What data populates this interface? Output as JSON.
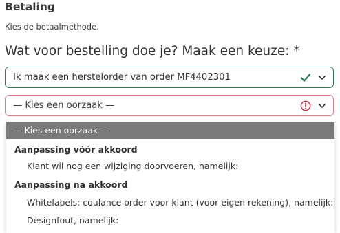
{
  "section": {
    "title": "Betaling",
    "subtitle": "Kies de betaalmethode."
  },
  "question": {
    "label": "Wat voor bestelling doe je? Maak een keuze: *"
  },
  "order_select": {
    "value": "Ik maak een herstelorder van order MF4402301",
    "status_icon": "check-icon",
    "status_color": "#2e7d55"
  },
  "reason_select": {
    "value": "— Kies een oorzaak —",
    "status_icon": "error-circle-icon",
    "status_color": "#d0314a"
  },
  "dropdown": {
    "selected_option": "— Kies een oorzaak —",
    "groups": [
      {
        "label": "Aanpassing vóór akkoord",
        "options": [
          "Klant wil nog een wijziging doorvoeren, namelijk:"
        ]
      },
      {
        "label": "Aanpassing na akkoord",
        "options": [
          "Whitelabels: coulance order voor klant (voor eigen rekening), namelijk:",
          "Designfout, namelijk:"
        ]
      }
    ]
  }
}
